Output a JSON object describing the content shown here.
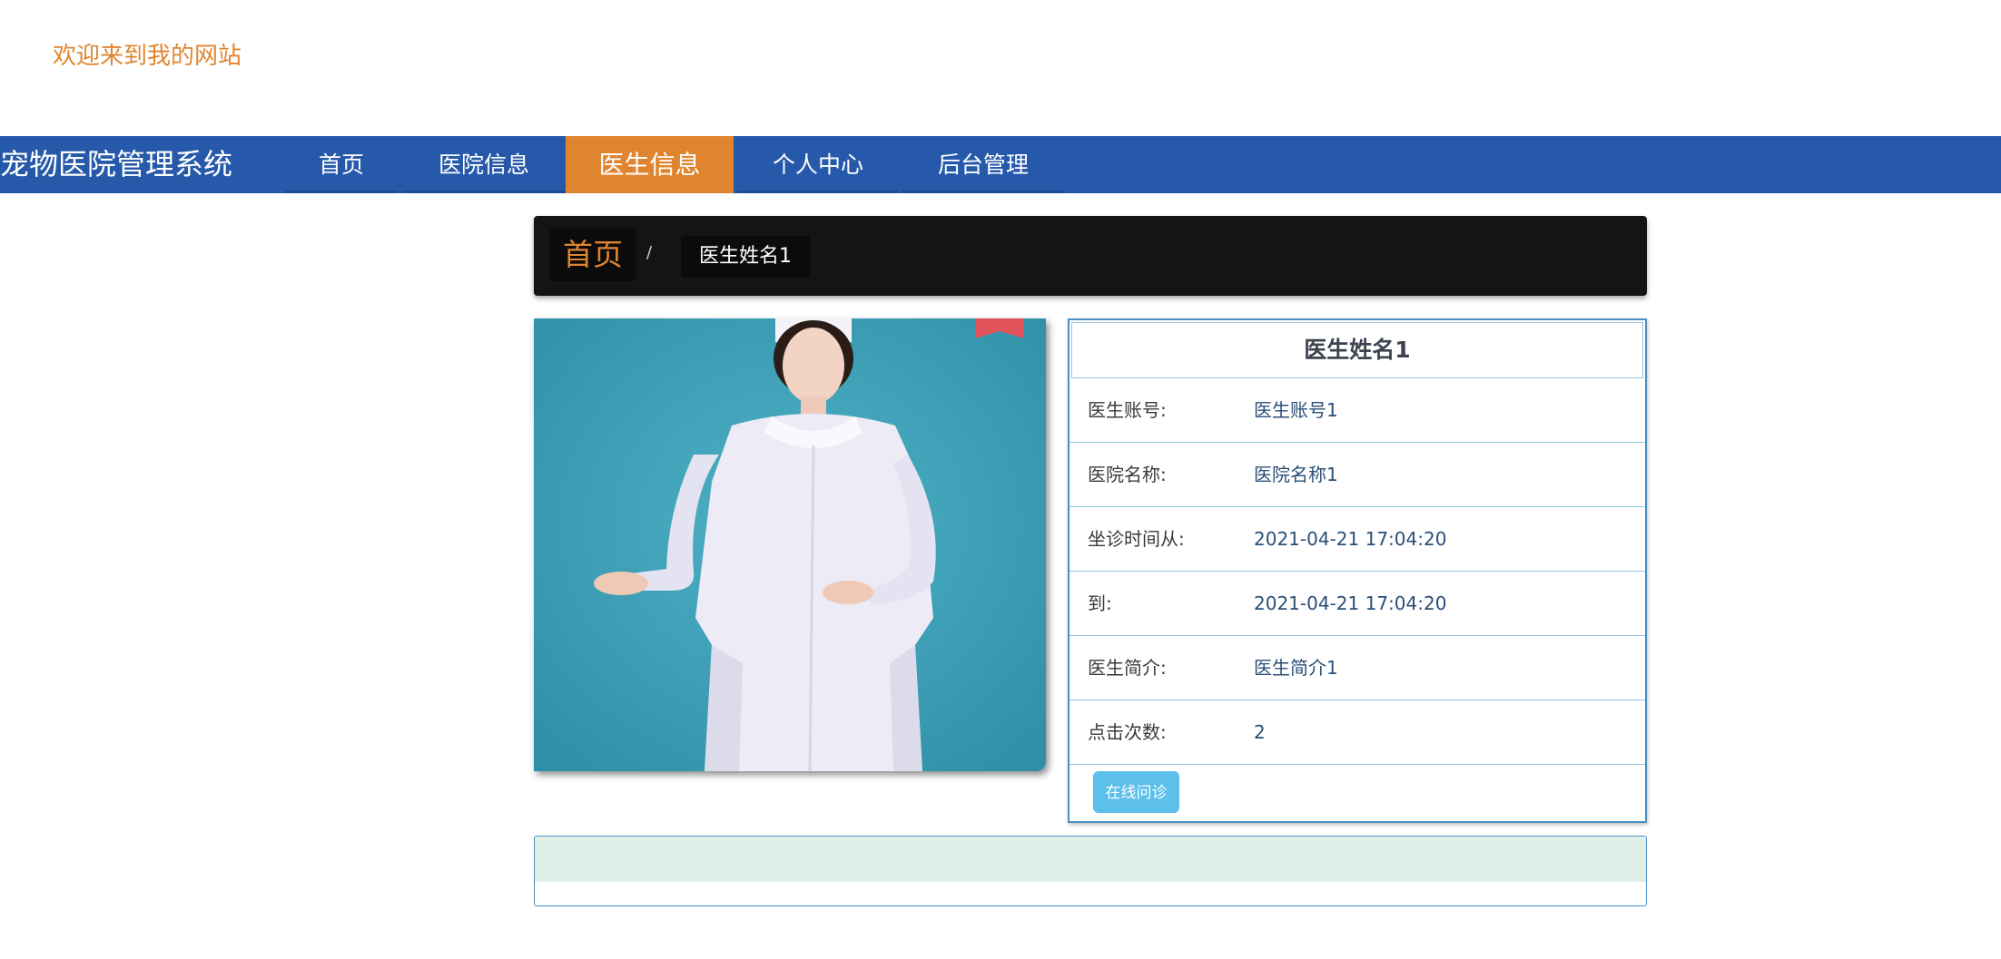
{
  "header": {
    "welcome_text": "欢迎来到我的网站"
  },
  "navbar": {
    "brand": "宠物医院管理系统",
    "items": [
      {
        "label": "首页"
      },
      {
        "label": "医院信息"
      },
      {
        "label": "医生信息"
      },
      {
        "label": "个人中心"
      },
      {
        "label": "后台管理"
      }
    ],
    "active_item": "医生信息",
    "background_color": "#2659aa",
    "active_color": "#e0852f"
  },
  "breadcrumb": {
    "home": "首页",
    "separator": "/",
    "current": "医生姓名1"
  },
  "doctor": {
    "photo_icon": "nurse-photo",
    "name": "医生姓名1",
    "fields": [
      {
        "label": "医生账号:",
        "value": "医生账号1"
      },
      {
        "label": "医院名称:",
        "value": "医院名称1"
      },
      {
        "label": "坐诊时间从:",
        "value": "2021-04-21 17:04:20"
      },
      {
        "label": "到:",
        "value": "2021-04-21 17:04:20"
      },
      {
        "label": "医生简介:",
        "value": "医生简介1"
      },
      {
        "label": "点击次数:",
        "value": "2"
      }
    ],
    "consult_button": "在线问诊"
  }
}
